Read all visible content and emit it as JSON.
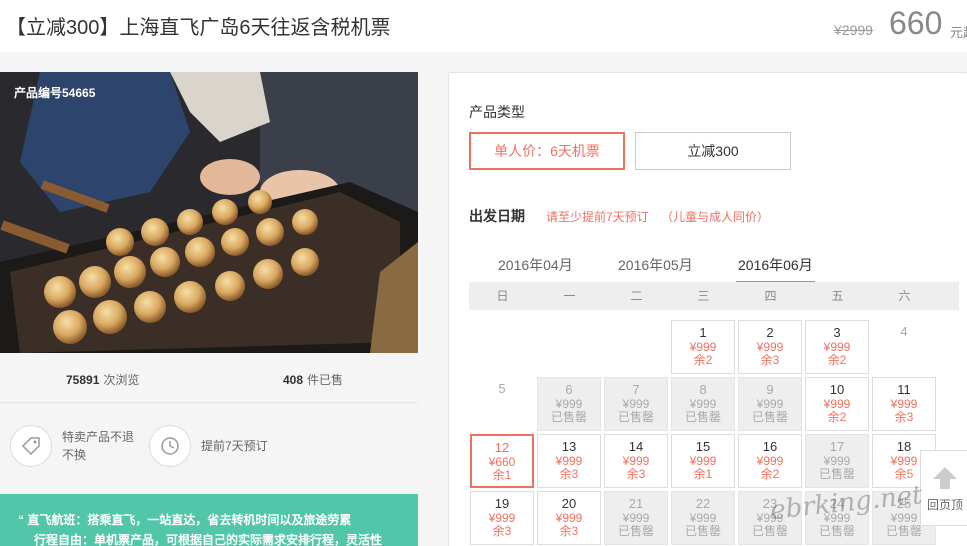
{
  "header": {
    "title": "【立减300】上海直飞广岛6天往返含税机票",
    "original_price": "¥2999",
    "price": "660",
    "price_unit": "元起"
  },
  "gallery": {
    "product_code": "产品编号54665"
  },
  "stats": {
    "views_count": "75891",
    "views_label": "次浏览",
    "sold_count": "408",
    "sold_label": "件已售"
  },
  "features": [
    {
      "icon": "tag-icon",
      "text": "特卖产品不退不换"
    },
    {
      "icon": "clock-icon",
      "text": "提前7天预订"
    }
  ],
  "promo": {
    "line1": "“ 直飞航班：搭乘直飞，一站直达，省去转机时间以及旅途劳累",
    "line2": "行程自由：单机票产品，可根据自己的实际需求安排行程，灵活性"
  },
  "booking": {
    "type_label": "产品类型",
    "types": [
      {
        "label": "单人价：6天机票",
        "active": true
      },
      {
        "label": "立减300",
        "active": false
      }
    ],
    "date_label": "出发日期",
    "date_hint1": "请至少提前7天预订",
    "date_hint2": "（儿童与成人同价）",
    "months": [
      {
        "label": "2016年04月",
        "active": false
      },
      {
        "label": "2016年05月",
        "active": false
      },
      {
        "label": "2016年06月",
        "active": true
      }
    ],
    "weekdays": [
      "日",
      "一",
      "二",
      "三",
      "四",
      "五",
      "六"
    ],
    "calendar": [
      {
        "day": "1",
        "col": 3,
        "row": 0,
        "state": "avail",
        "price": "¥999",
        "stock": "余2"
      },
      {
        "day": "2",
        "col": 4,
        "row": 0,
        "state": "avail",
        "price": "¥999",
        "stock": "余3"
      },
      {
        "day": "3",
        "col": 5,
        "row": 0,
        "state": "avail",
        "price": "¥999",
        "stock": "余2"
      },
      {
        "day": "4",
        "col": 6,
        "row": 0,
        "state": "empty",
        "price": "",
        "stock": ""
      },
      {
        "day": "5",
        "col": 0,
        "row": 1,
        "state": "empty",
        "price": "",
        "stock": ""
      },
      {
        "day": "6",
        "col": 1,
        "row": 1,
        "state": "sold",
        "price": "¥999",
        "stock": "已售罄"
      },
      {
        "day": "7",
        "col": 2,
        "row": 1,
        "state": "sold",
        "price": "¥999",
        "stock": "已售罄"
      },
      {
        "day": "8",
        "col": 3,
        "row": 1,
        "state": "sold",
        "price": "¥999",
        "stock": "已售罄"
      },
      {
        "day": "9",
        "col": 4,
        "row": 1,
        "state": "sold",
        "price": "¥999",
        "stock": "已售罄"
      },
      {
        "day": "10",
        "col": 5,
        "row": 1,
        "state": "avail",
        "price": "¥999",
        "stock": "余2"
      },
      {
        "day": "11",
        "col": 6,
        "row": 1,
        "state": "avail",
        "price": "¥999",
        "stock": "余3"
      },
      {
        "day": "12",
        "col": 0,
        "row": 2,
        "state": "selected",
        "price": "¥660",
        "stock": "余1"
      },
      {
        "day": "13",
        "col": 1,
        "row": 2,
        "state": "avail",
        "price": "¥999",
        "stock": "余3"
      },
      {
        "day": "14",
        "col": 2,
        "row": 2,
        "state": "avail",
        "price": "¥999",
        "stock": "余3"
      },
      {
        "day": "15",
        "col": 3,
        "row": 2,
        "state": "avail",
        "price": "¥999",
        "stock": "余1"
      },
      {
        "day": "16",
        "col": 4,
        "row": 2,
        "state": "avail",
        "price": "¥999",
        "stock": "余2"
      },
      {
        "day": "17",
        "col": 5,
        "row": 2,
        "state": "sold",
        "price": "¥999",
        "stock": "已售罄"
      },
      {
        "day": "18",
        "col": 6,
        "row": 2,
        "state": "avail",
        "price": "¥999",
        "stock": "余5"
      },
      {
        "day": "19",
        "col": 0,
        "row": 3,
        "state": "avail",
        "price": "¥999",
        "stock": "余3"
      },
      {
        "day": "20",
        "col": 1,
        "row": 3,
        "state": "avail",
        "price": "¥999",
        "stock": "余3"
      },
      {
        "day": "21",
        "col": 2,
        "row": 3,
        "state": "sold",
        "price": "¥999",
        "stock": "已售罄"
      },
      {
        "day": "22",
        "col": 3,
        "row": 3,
        "state": "sold",
        "price": "¥999",
        "stock": "已售罄"
      },
      {
        "day": "23",
        "col": 4,
        "row": 3,
        "state": "sold",
        "price": "¥999",
        "stock": "已售罄"
      },
      {
        "day": "24",
        "col": 5,
        "row": 3,
        "state": "sold",
        "price": "¥999",
        "stock": "已售罄"
      },
      {
        "day": "25",
        "col": 6,
        "row": 3,
        "state": "sold",
        "price": "¥999",
        "stock": "已售罄"
      }
    ]
  },
  "back_to_top": {
    "label": "回页顶",
    "icon": "arrow-up-icon"
  },
  "watermark": {
    "text": "ebrking.net"
  }
}
